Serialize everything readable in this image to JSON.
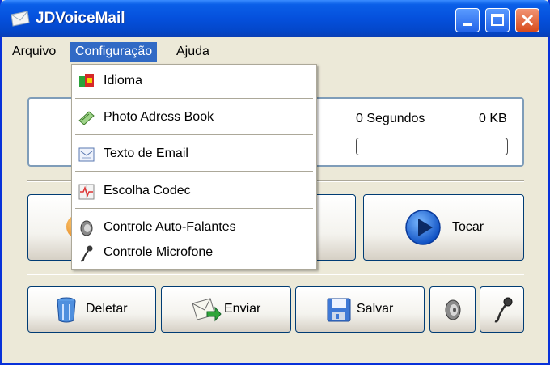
{
  "window": {
    "title": "JDVoiceMail"
  },
  "menu": {
    "arquivo": "Arquivo",
    "configuracao": "Configuração",
    "ajuda": "Ajuda"
  },
  "dropdown": {
    "items": [
      {
        "label": "Idioma",
        "icon": "flag-icon"
      },
      {
        "label": "Photo Adress Book",
        "icon": "address-book-icon"
      },
      {
        "label": "Texto de Email",
        "icon": "email-text-icon"
      },
      {
        "label": "Escolha Codec",
        "icon": "codec-icon"
      },
      {
        "label": "Controle Auto-Falantes",
        "icon": "speaker-icon"
      },
      {
        "label": "Controle Microfone",
        "icon": "microphone-icon"
      }
    ]
  },
  "status": {
    "seconds": "0 Segundos",
    "size": "0 KB",
    "progress": 0
  },
  "buttons": {
    "play": "Tocar",
    "delete": "Deletar",
    "send": "Enviar",
    "save": "Salvar"
  },
  "colors": {
    "titlebar": "#0550dc",
    "menu_highlight": "#316ac5",
    "play_blue": "#1f6fe0"
  }
}
